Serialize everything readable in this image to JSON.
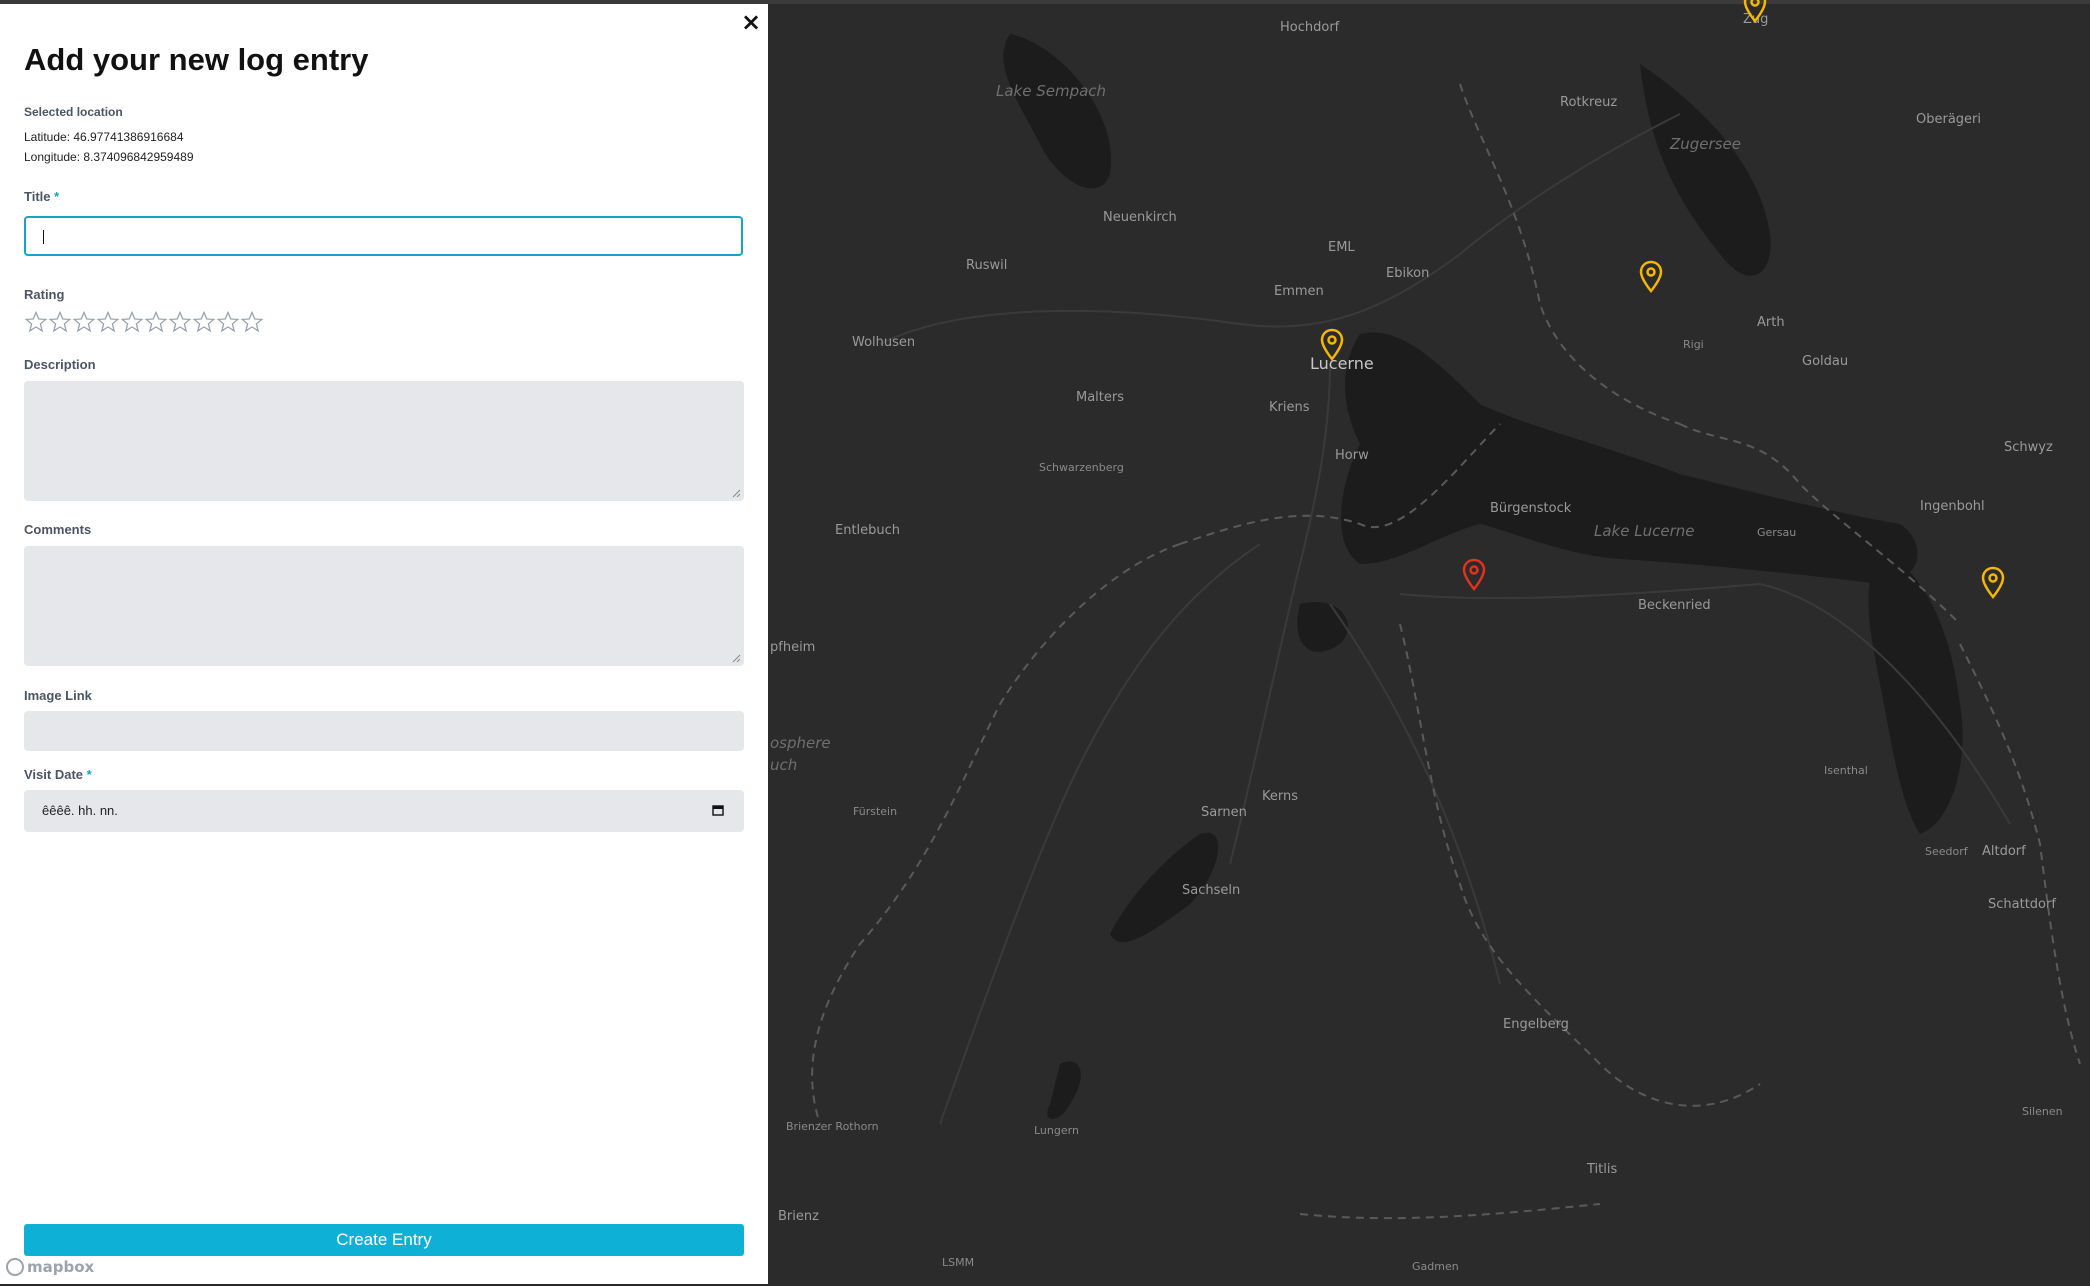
{
  "form": {
    "heading": "Add your new log entry",
    "close_icon": "×",
    "selected_location_label": "Selected location",
    "latitude_text": "Latitude: 46.97741386916684",
    "longitude_text": "Longitude: 8.374096842959489",
    "title_label": "Title",
    "required_mark": "*",
    "title_value": "",
    "rating_label": "Rating",
    "rating_value": 0,
    "rating_max": 10,
    "description_label": "Description",
    "description_value": "",
    "comments_label": "Comments",
    "comments_value": "",
    "image_link_label": "Image Link",
    "image_link_value": "",
    "visit_date_label": "Visit Date",
    "visit_date_placeholder": "êêêê. hh. nn.",
    "submit_label": "Create Entry",
    "accent_color": "#0fb0d6"
  },
  "map": {
    "attribution_logo": "mapbox",
    "labels": [
      {
        "text": "Hochdorf",
        "style": "normal"
      },
      {
        "text": "Zug",
        "style": "normal"
      },
      {
        "text": "Lake Sempach",
        "style": "italic"
      },
      {
        "text": "Rotkreuz",
        "style": "normal"
      },
      {
        "text": "Oberägeri",
        "style": "normal"
      },
      {
        "text": "Zugersee",
        "style": "italic"
      },
      {
        "text": "Neuenkirch",
        "style": "normal"
      },
      {
        "text": "EML",
        "style": "normal"
      },
      {
        "text": "Ruswil",
        "style": "normal"
      },
      {
        "text": "Ebikon",
        "style": "normal"
      },
      {
        "text": "Emmen",
        "style": "normal"
      },
      {
        "text": "Arth",
        "style": "normal"
      },
      {
        "text": "Rigi",
        "style": "small"
      },
      {
        "text": "Goldau",
        "style": "normal"
      },
      {
        "text": "Wolhusen",
        "style": "normal"
      },
      {
        "text": "Lucerne",
        "style": "city"
      },
      {
        "text": "Malters",
        "style": "normal"
      },
      {
        "text": "Kriens",
        "style": "normal"
      },
      {
        "text": "Schwyz",
        "style": "normal"
      },
      {
        "text": "Schwarzenberg",
        "style": "small"
      },
      {
        "text": "Horw",
        "style": "normal"
      },
      {
        "text": "Bürgenstock",
        "style": "normal"
      },
      {
        "text": "Ingenbohl",
        "style": "normal"
      },
      {
        "text": "Entlebuch",
        "style": "normal"
      },
      {
        "text": "Lake Lucerne",
        "style": "italic"
      },
      {
        "text": "Gersau",
        "style": "small"
      },
      {
        "text": "Beckenried",
        "style": "normal"
      },
      {
        "text": "pfheim",
        "style": "normal"
      },
      {
        "text": "osphere",
        "style": "italic"
      },
      {
        "text": "uch",
        "style": "italic"
      },
      {
        "text": "Isenthal",
        "style": "small"
      },
      {
        "text": "Fürstein",
        "style": "small"
      },
      {
        "text": "Sarnen",
        "style": "normal"
      },
      {
        "text": "Kerns",
        "style": "normal"
      },
      {
        "text": "Seedorf",
        "style": "small"
      },
      {
        "text": "Altdorf",
        "style": "normal"
      },
      {
        "text": "Sachseln",
        "style": "normal"
      },
      {
        "text": "Schattdorf",
        "style": "normal"
      },
      {
        "text": "Engelberg",
        "style": "normal"
      },
      {
        "text": "Silenen",
        "style": "small"
      },
      {
        "text": "Brienzer Rothorn",
        "style": "small"
      },
      {
        "text": "Lungern",
        "style": "small"
      },
      {
        "text": "Titlis",
        "style": "normal"
      },
      {
        "text": "Brienz",
        "style": "normal"
      },
      {
        "text": "LSMM",
        "style": "small"
      },
      {
        "text": "Gadmen",
        "style": "small"
      }
    ],
    "markers": [
      {
        "name": "log-marker-zug",
        "color": "#f5b700"
      },
      {
        "name": "log-marker-rigi",
        "color": "#f5b700"
      },
      {
        "name": "log-marker-lucerne",
        "color": "#f5b700"
      },
      {
        "name": "log-marker-brunnen",
        "color": "#f5b700"
      },
      {
        "name": "selected-location-marker",
        "color": "#e0321f"
      }
    ]
  }
}
